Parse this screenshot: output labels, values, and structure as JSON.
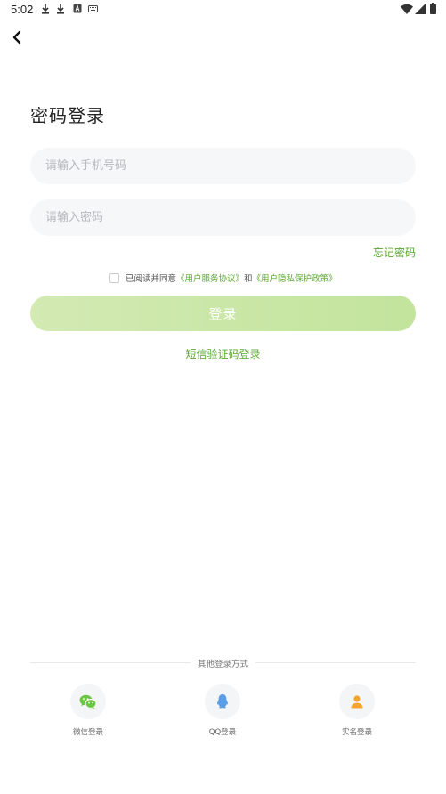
{
  "status_bar": {
    "time": "5:02"
  },
  "page": {
    "title": "密码登录"
  },
  "form": {
    "phone_placeholder": "请输入手机号码",
    "password_placeholder": "请输入密码",
    "forgot_label": "忘记密码"
  },
  "agreement": {
    "prefix": "已阅读并同意",
    "service_link": "《用户服务协议》",
    "and": "和",
    "privacy_link": "《用户隐私保护政策》"
  },
  "login_button_label": "登录",
  "sms_login_label": "短信验证码登录",
  "other_login": {
    "title": "其他登录方式",
    "options": [
      {
        "label": "微信登录",
        "icon": "wechat-icon",
        "color": "#6cc644"
      },
      {
        "label": "QQ登录",
        "icon": "qq-icon",
        "color": "#5a9ee8"
      },
      {
        "label": "实名登录",
        "icon": "user-icon",
        "color": "#f4a62a"
      }
    ]
  },
  "colors": {
    "accent": "#5aa832",
    "button": "#c6e6a2"
  }
}
